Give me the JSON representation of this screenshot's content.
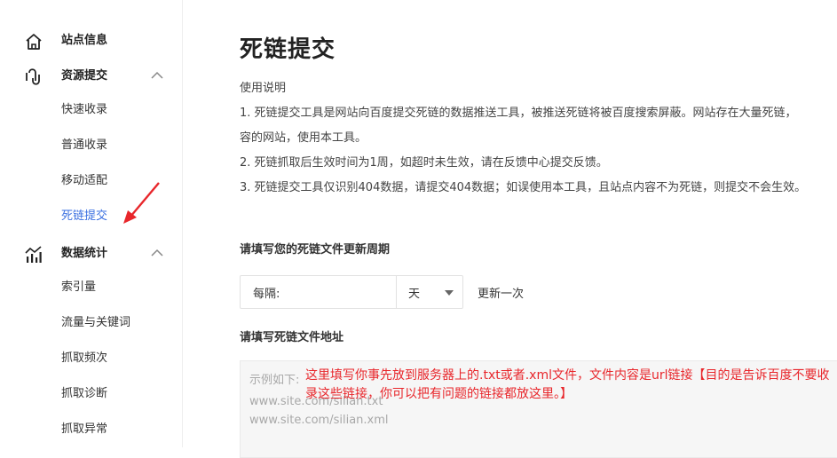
{
  "sidebar": {
    "groups": [
      {
        "label": "站点信息",
        "icon": "home-icon"
      },
      {
        "label": "资源提交",
        "icon": "upload-icon",
        "expanded": true,
        "items": [
          "快速收录",
          "普通收录",
          "移动适配",
          "死链提交"
        ]
      },
      {
        "label": "数据统计",
        "icon": "stats-icon",
        "expanded": true,
        "items": [
          "索引量",
          "流量与关键词",
          "抓取频次",
          "抓取诊断",
          "抓取异常"
        ]
      }
    ],
    "active_item": "死链提交"
  },
  "main": {
    "title": "死链提交",
    "usage": [
      "使用说明",
      "1. 死链提交工具是网站向百度提交死链的数据推送工具，被推送死链将被百度搜索屏蔽。网站存在大量死链，",
      "容的网站，使用本工具。",
      "2. 死链抓取后生效时间为1周，如超时未生效，请在反馈中心提交反馈。",
      "3. 死链提交工具仅识别404数据，请提交404数据；如误使用本工具，且站点内容不为死链，则提交不会生效。"
    ],
    "period_label": "请填写您的死链文件更新周期",
    "period_prefix": "每隔:",
    "period_unit": "天",
    "period_suffix": "更新一次",
    "url_label": "请填写死链文件地址",
    "url_placeholder": [
      "示例如下:",
      "www.site.com/silian.txt",
      "www.site.com/silian.xml"
    ]
  },
  "annotation": {
    "text": "这里填写你事先放到服务器上的.txt或者.xml文件，文件内容是url链接【目的是告诉百度不要收录这些链接，你可以把有问题的链接都放这里。】",
    "color": "#e8262b"
  },
  "colors": {
    "accent": "#3a6fe0",
    "annotation": "#e8262b"
  }
}
